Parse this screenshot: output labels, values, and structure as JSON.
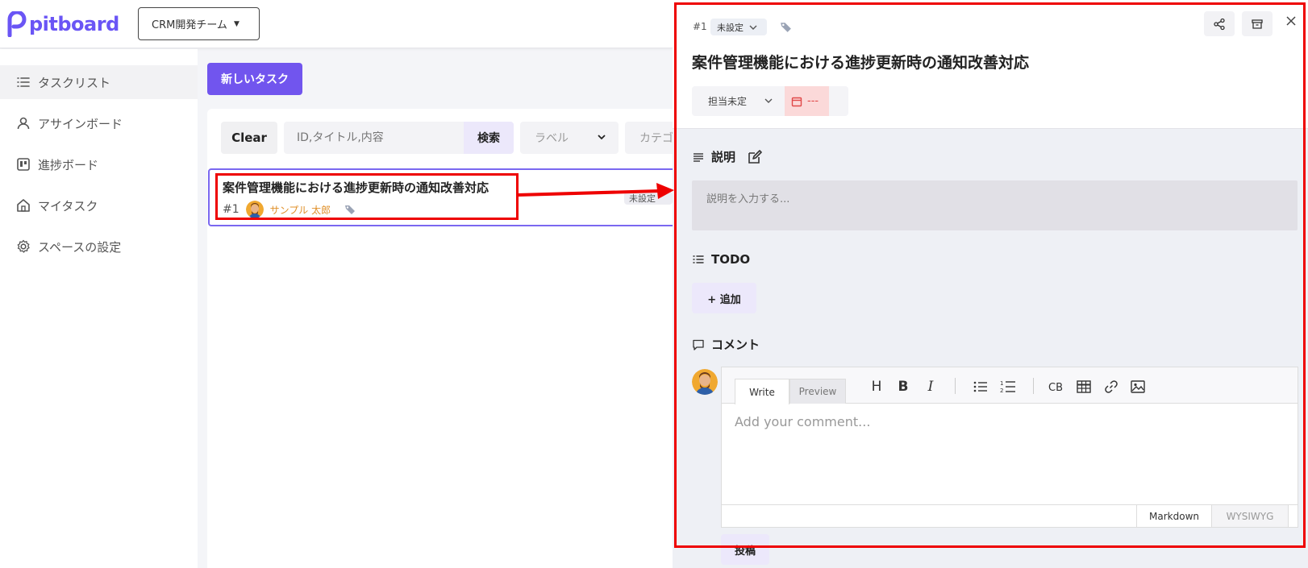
{
  "app": {
    "brand": "pitboard",
    "team": "CRM開発チーム"
  },
  "sidebar": {
    "items": [
      {
        "label": "タスクリスト",
        "icon": "list-icon",
        "active": true
      },
      {
        "label": "アサインボード",
        "icon": "user-icon"
      },
      {
        "label": "進捗ボード",
        "icon": "board-icon"
      },
      {
        "label": "マイタスク",
        "icon": "home-icon"
      },
      {
        "label": "スペースの設定",
        "icon": "gear-icon"
      }
    ]
  },
  "main": {
    "new_task_label": "新しいタスク",
    "filters": {
      "clear_label": "Clear",
      "search_placeholder": "ID,タイトル,内容",
      "search_label": "検索",
      "label_select": "ラベル",
      "category_select": "カテゴ"
    },
    "task": {
      "title": "案件管理機能における進捗更新時の通知改善対応",
      "id": "#1",
      "assignee": "サンプル 太郎",
      "status": "未設定"
    }
  },
  "detail": {
    "id": "#1",
    "status": "未設定",
    "title": "案件管理機能における進捗更新時の通知改善対応",
    "assignee": "担当未定",
    "date": "---",
    "description_heading": "説明",
    "description_placeholder": "説明を入力する...",
    "todo_heading": "TODO",
    "add_label": "+ 追加",
    "comment_heading": "コメント",
    "editor": {
      "tab_write": "Write",
      "tab_preview": "Preview",
      "placeholder": "Add your comment...",
      "mode_markdown": "Markdown",
      "mode_wysiwyg": "WYSIWYG"
    },
    "post_label": "投稿"
  },
  "colors": {
    "brand": "#6a55f5",
    "highlight": "#ee0000",
    "assignee": "#e0902a"
  }
}
